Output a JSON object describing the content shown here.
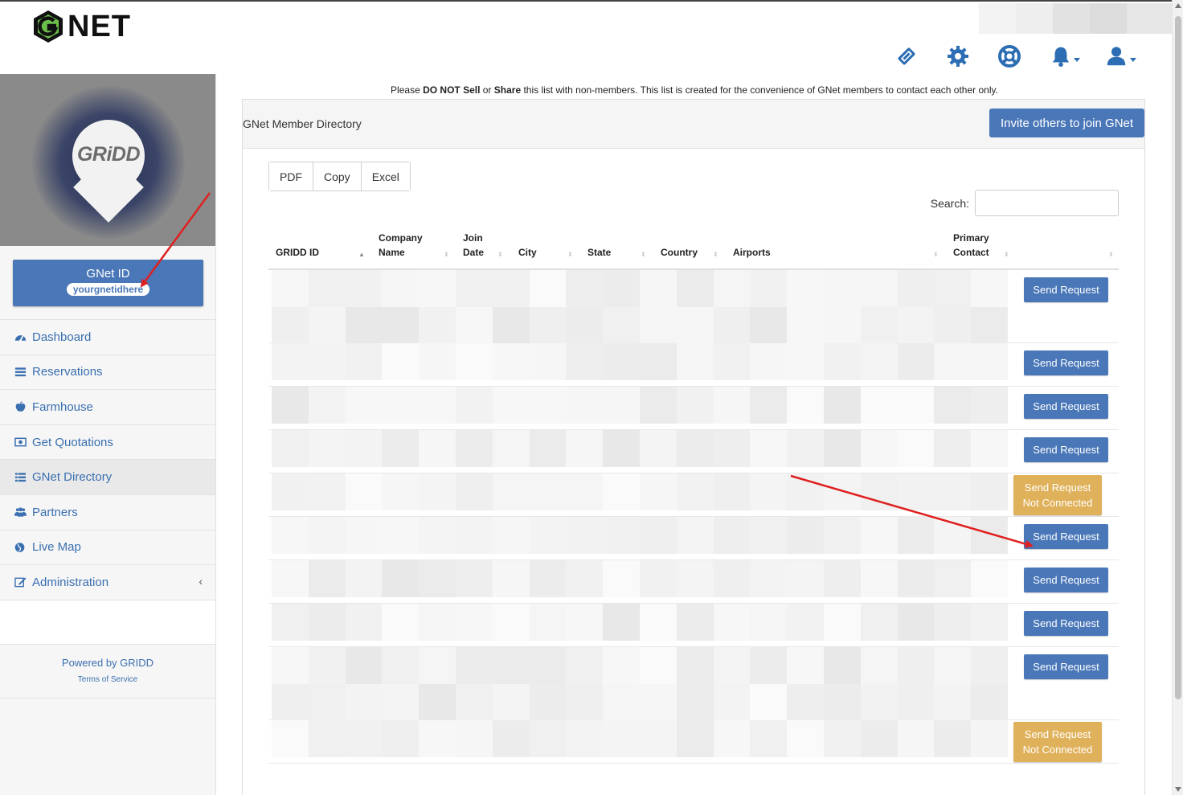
{
  "brand": {
    "logo_letter": "G",
    "logo_text": "NET"
  },
  "header": {
    "icons": [
      "ticket-icon",
      "gear-icon",
      "lifebuoy-icon",
      "bell-icon",
      "user-icon"
    ]
  },
  "sidebar": {
    "profile_logo_text": "GRiDD",
    "gnet_id_label": "GNet ID",
    "gnet_id_value": "yourgnetidhere",
    "nav": [
      {
        "label": "Dashboard",
        "icon": "dashboard-icon"
      },
      {
        "label": "Reservations",
        "icon": "list-icon"
      },
      {
        "label": "Farmhouse",
        "icon": "apple-icon"
      },
      {
        "label": "Get Quotations",
        "icon": "money-icon"
      },
      {
        "label": "GNet Directory",
        "icon": "list-icon"
      },
      {
        "label": "Partners",
        "icon": "users-icon"
      },
      {
        "label": "Live Map",
        "icon": "globe-icon"
      },
      {
        "label": "Administration",
        "icon": "edit-icon"
      }
    ],
    "powered_by": "Powered by GRIDD",
    "terms": "Terms of Service"
  },
  "notice": {
    "prefix": "Please ",
    "bold1": "DO NOT Sell",
    "mid": " or ",
    "bold2": "Share",
    "suffix": " this list with non-members. This list is created for the convenience of GNet members to contact each other only."
  },
  "panel": {
    "title": "GNet Member Directory",
    "invite_button": "Invite others to join GNet",
    "export_buttons": [
      "PDF",
      "Copy",
      "Excel"
    ],
    "search_label": "Search:",
    "search_value": ""
  },
  "table": {
    "columns": [
      {
        "line1": "GRIDD ID",
        "line2": ""
      },
      {
        "line1": "Company",
        "line2": "Name"
      },
      {
        "line1": "Join",
        "line2": "Date"
      },
      {
        "line1": "City",
        "line2": ""
      },
      {
        "line1": "State",
        "line2": ""
      },
      {
        "line1": "Country",
        "line2": ""
      },
      {
        "line1": "Airports",
        "line2": ""
      },
      {
        "line1": "Primary",
        "line2": "Contact"
      }
    ],
    "send_request": "Send Request",
    "not_connected": "Not Connected",
    "rows": [
      {
        "status": "send"
      },
      {
        "status": "send"
      },
      {
        "status": "send"
      },
      {
        "status": "send"
      },
      {
        "status": "not_connected"
      },
      {
        "status": "send"
      },
      {
        "status": "send"
      },
      {
        "status": "send"
      },
      {
        "status": "send"
      },
      {
        "status": "not_connected"
      }
    ]
  },
  "colors": {
    "primary": "#4a77b8",
    "warning": "#e0b15b",
    "annotation_arrow": "#e02020"
  }
}
